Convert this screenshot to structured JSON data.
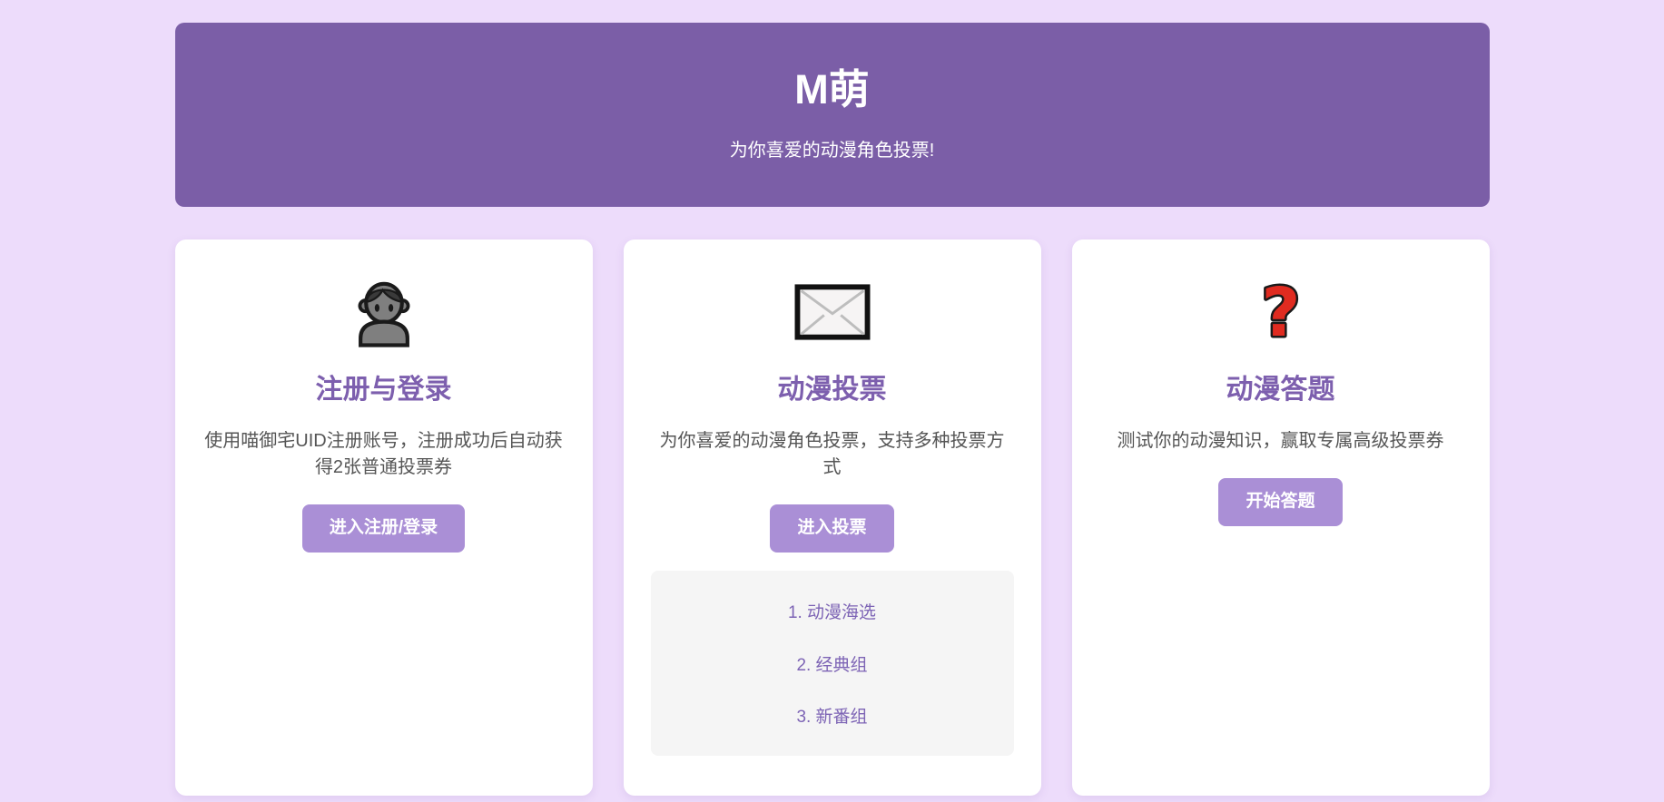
{
  "header": {
    "title": "M萌",
    "subtitle": "为你喜爱的动漫角色投票!"
  },
  "cards": [
    {
      "icon": "person-icon",
      "title": "注册与登录",
      "description": "使用喵御宅UID注册账号，注册成功后自动获得2张普通投票券",
      "button_label": "进入注册/登录"
    },
    {
      "icon": "envelope-icon",
      "title": "动漫投票",
      "description": "为你喜爱的动漫角色投票，支持多种投票方式",
      "button_label": "进入投票",
      "links": [
        "1. 动漫海选",
        "2. 经典组",
        "3. 新番组"
      ]
    },
    {
      "icon": "question-mark-icon",
      "title": "动漫答题",
      "description": "测试你的动漫知识，赢取专属高级投票券",
      "button_label": "开始答题"
    }
  ],
  "colors": {
    "page_background": "#eddcfb",
    "hero_background": "#7b5ea7",
    "card_background": "#ffffff",
    "heading": "#7d5fae",
    "button": "#aa8fd6",
    "link": "#7d64b5",
    "body_text": "#555555",
    "list_box_background": "#f5f5f5",
    "question_mark_red": "#e02b20"
  }
}
